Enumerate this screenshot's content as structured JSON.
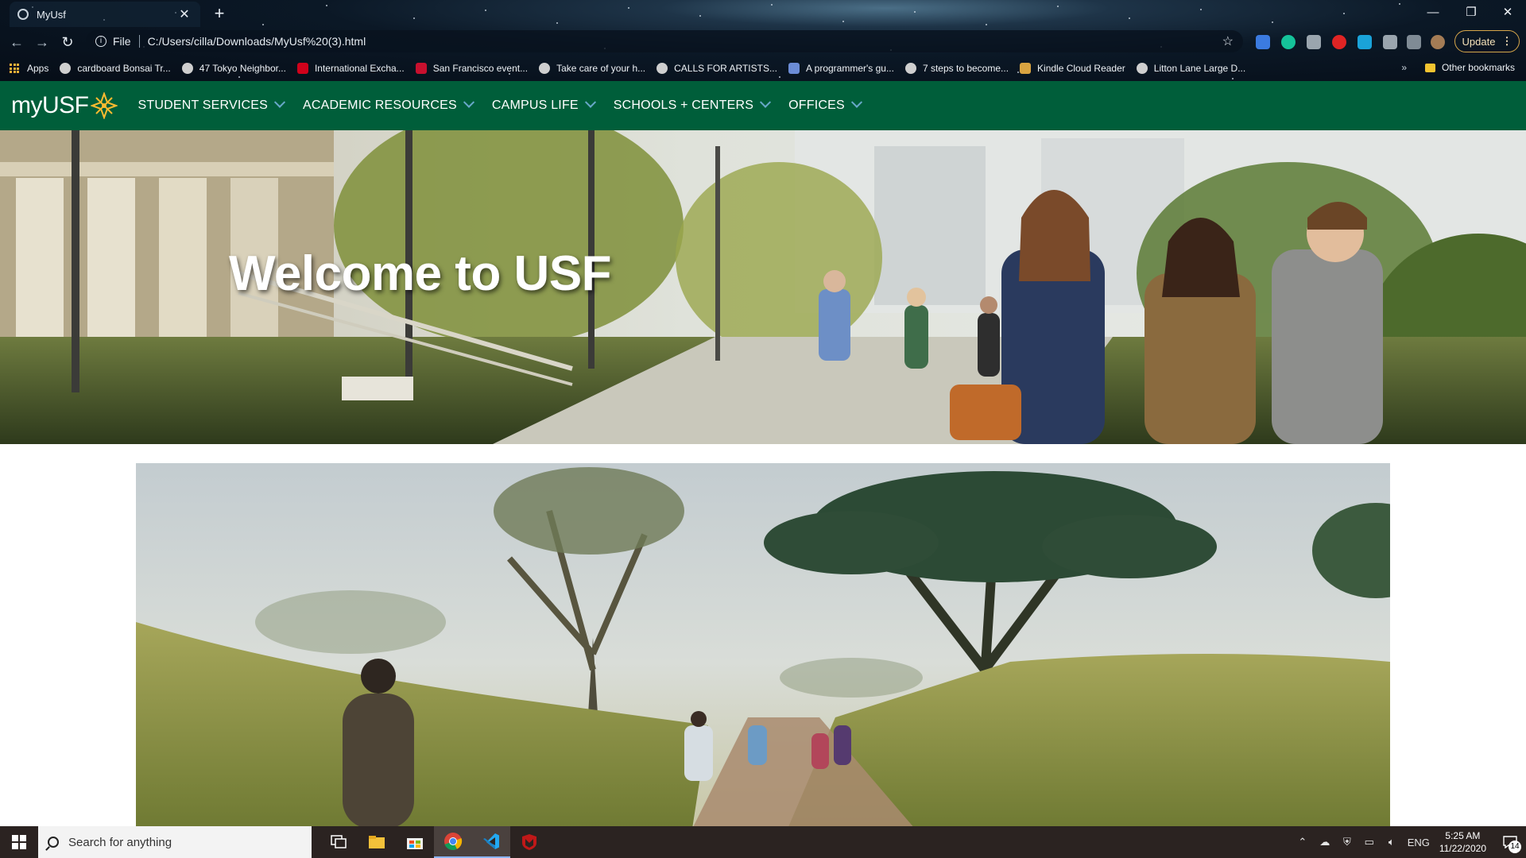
{
  "browser": {
    "tab": {
      "title": "MyUsf",
      "close": "✕"
    },
    "new_tab": "+",
    "window_controls": {
      "minimize": "—",
      "restore": "❐",
      "close": "✕"
    },
    "address": {
      "scheme": "File",
      "url": "C:/Users/cilla/Downloads/MyUsf%20(3).html"
    },
    "update_button": "Update",
    "bookmarks": [
      {
        "label": "Apps",
        "icon": "apps-grid-icon"
      },
      {
        "label": "cardboard Bonsai Tr...",
        "icon": "globe-icon",
        "color": "#cfcfcf"
      },
      {
        "label": "47 Tokyo Neighbor...",
        "icon": "globe-icon",
        "color": "#cfcfcf"
      },
      {
        "label": "International Excha...",
        "icon": "maple-leaf-icon",
        "color": "#d0021b"
      },
      {
        "label": "San Francisco event...",
        "icon": "flag-icon",
        "color": "#c8102e"
      },
      {
        "label": "Take care of your h...",
        "icon": "globe-icon",
        "color": "#cfcfcf"
      },
      {
        "label": "CALLS FOR ARTISTS...",
        "icon": "globe-icon",
        "color": "#cfcfcf"
      },
      {
        "label": "A programmer's gu...",
        "icon": "book-icon",
        "color": "#6b8cd6"
      },
      {
        "label": "7 steps to become...",
        "icon": "globe-icon",
        "color": "#cfcfcf"
      },
      {
        "label": "Kindle Cloud Reader",
        "icon": "kindle-icon",
        "color": "#d9a441"
      },
      {
        "label": "Litton Lane Large D...",
        "icon": "globe-icon",
        "color": "#cfcfcf"
      }
    ],
    "bookmarks_overflow": "»",
    "other_bookmarks": "Other bookmarks"
  },
  "site": {
    "logo_text": "myUSF",
    "nav": [
      {
        "label": "STUDENT SERVICES"
      },
      {
        "label": "ACADEMIC RESOURCES"
      },
      {
        "label": "CAMPUS LIFE"
      },
      {
        "label": "SCHOOLS + CENTERS"
      },
      {
        "label": "OFFICES"
      }
    ],
    "hero_title": "Welcome to USF",
    "colors": {
      "brand_green": "#005e3a",
      "brand_gold": "#fdbb30",
      "nav_chevron": "#68a8c9"
    }
  },
  "taskbar": {
    "search_placeholder": "Search for anything",
    "language": "ENG",
    "time": "5:25 AM",
    "date": "11/22/2020",
    "notification_count": "14"
  }
}
